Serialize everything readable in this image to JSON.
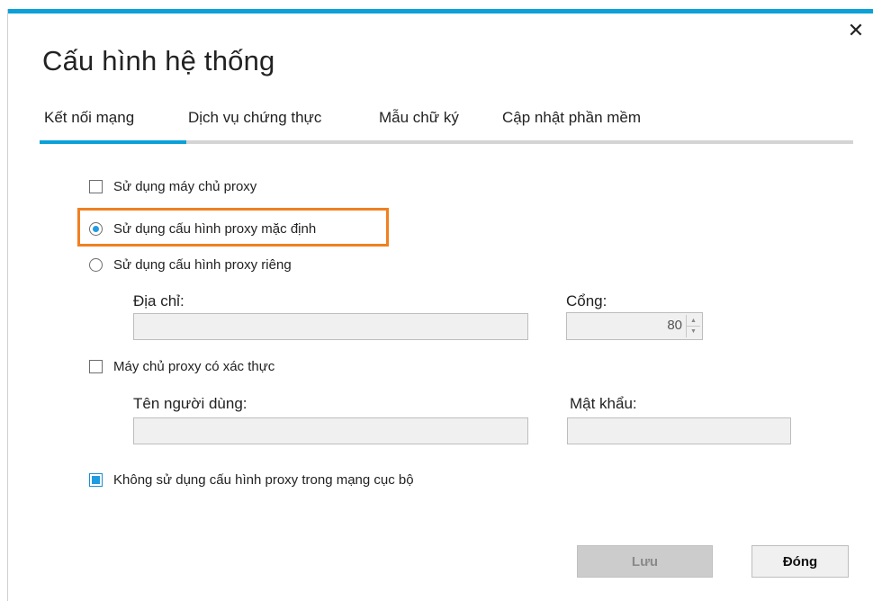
{
  "colors": {
    "accent": "#0aa0d8",
    "highlight": "#f08022",
    "checked": "#1f9be0"
  },
  "dialog": {
    "title": "Cấu hình hệ thống",
    "close_icon": "close-icon"
  },
  "tabs": [
    {
      "label": "Kết nối mạng",
      "active": true
    },
    {
      "label": "Dịch vụ chứng thực",
      "active": false
    },
    {
      "label": "Mẫu chữ ký",
      "active": false
    },
    {
      "label": "Cập nhật phần mềm",
      "active": false
    }
  ],
  "proxy": {
    "use_proxy_label": "Sử dụng máy chủ proxy",
    "use_proxy_checked": false,
    "default_proxy_label": "Sử dụng cấu hình proxy mặc định",
    "default_proxy_selected": true,
    "custom_proxy_label": "Sử dụng cấu hình proxy riêng",
    "custom_proxy_selected": false,
    "address_label": "Địa chỉ:",
    "address_value": "",
    "port_label": "Cổng:",
    "port_value": "80",
    "auth_label": "Máy chủ proxy có xác thực",
    "auth_checked": false,
    "username_label": "Tên người dùng:",
    "username_value": "",
    "password_label": "Mật khẩu:",
    "password_value": "",
    "bypass_local_label": "Không sử dụng cấu hình proxy trong mạng cục bộ",
    "bypass_local_checked": true
  },
  "buttons": {
    "save_label": "Lưu",
    "close_label": "Đóng"
  }
}
